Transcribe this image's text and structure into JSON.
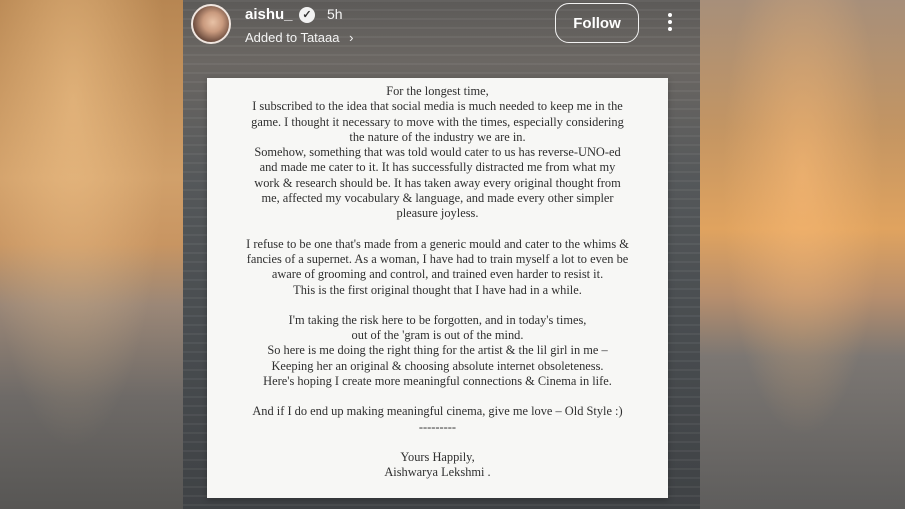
{
  "story": {
    "username": "aishu_",
    "verified_icon": "verified-badge-icon",
    "time_ago": "5h",
    "added_to_prefix": "Added to",
    "added_to_name": "Tataaa",
    "follow_label": "Follow",
    "more_icon": "more-vertical-icon"
  },
  "note": {
    "para1": [
      "For the longest time,",
      "I subscribed to the idea that social media is much needed to keep me in the",
      "game. I thought it necessary to move with the times, especially considering",
      "the nature of the industry we are in.",
      "Somehow, something that was told would cater to us has reverse-UNO-ed",
      "and made me cater to it. It has successfully distracted me from what my",
      "work & research should be. It has taken away every original thought from",
      "me, affected my vocabulary & language, and made every other simpler",
      "pleasure joyless."
    ],
    "para2": [
      "I refuse to be one that's made from a generic mould and cater to the whims &",
      "fancies of a supernet. As a woman, I have had to train myself a lot to even be",
      "aware of grooming and control, and trained even harder to resist it.",
      "This is the first original thought that I have had in a while."
    ],
    "para3": [
      "I'm taking the risk here to be forgotten, and in today's times,",
      "out of the 'gram is out of the mind.",
      "So here is me doing the right thing for the artist & the lil girl in me –",
      "Keeping her an original & choosing absolute internet obsoleteness.",
      "Here's hoping I create more meaningful connections & Cinema in life."
    ],
    "para4": [
      "And if I do end up making meaningful cinema, give me love – Old Style :)",
      "---------"
    ],
    "signoff": [
      "Yours Happily,",
      "Aishwarya Lekshmi ."
    ]
  }
}
